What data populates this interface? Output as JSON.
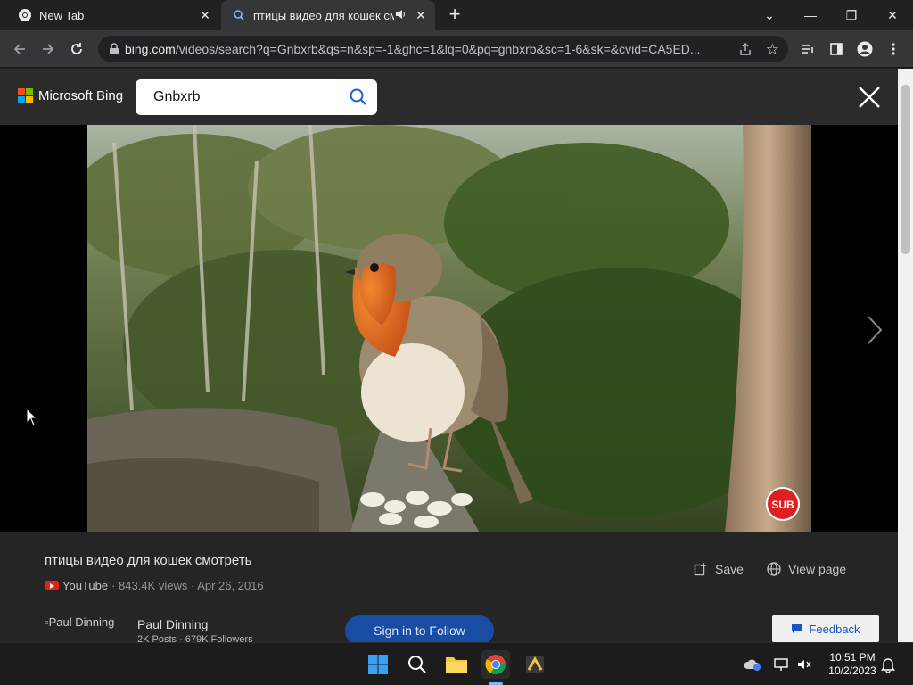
{
  "browser": {
    "tabs": [
      {
        "title": "New Tab",
        "favicon": "chrome-icon"
      },
      {
        "title": "птицы видео для кошек смотреть",
        "favicon": "bing-search-icon",
        "audio": true
      }
    ],
    "url_host": "bing.com",
    "url_rest": "/videos/search?q=Gnbxrb&qs=n&sp=-1&ghc=1&lq=0&pq=gnbxrb&sc=1-6&sk=&cvid=CA5ED..."
  },
  "bing": {
    "brand": "Microsoft Bing",
    "search_query": "Gnbxrb",
    "logo_colors": [
      "#f25022",
      "#7fba00",
      "#00a4ef",
      "#ffb900"
    ]
  },
  "video": {
    "title": "птицы видео для кошек смотреть",
    "source": "YouTube",
    "meta": "· 843.4K views · Apr 26, 2016",
    "sub_badge": "SUB",
    "save_label": "Save",
    "view_page_label": "View page",
    "channel_avatar_alt": "Paul Dinning",
    "channel_name": "Paul Dinning",
    "channel_stats": "2K Posts · 679K Followers",
    "signin_label": "Sign in to Follow",
    "feedback_label": "Feedback"
  },
  "taskbar": {
    "time": "10:51 PM",
    "date": "10/2/2023"
  },
  "colors": {
    "accent": "#1a4fa8",
    "robin_breast": "#e06a1c"
  }
}
